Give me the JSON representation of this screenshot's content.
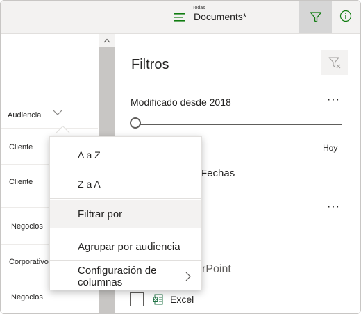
{
  "header": {
    "view_small_label": "Todas",
    "view_name": "Documents*"
  },
  "list": {
    "column_header": "Audiencia",
    "rows": [
      "Cliente",
      "Cliente",
      "Negocios",
      "Corporativo",
      "Negocios"
    ]
  },
  "filter_pane": {
    "title": "Filtros",
    "modified_section": "Modificado desde 2018",
    "slider_end_label": "Hoy",
    "dates_label": "Fechas",
    "partial_label": "rPoint",
    "excel_label": "Excel",
    "more_label": "···"
  },
  "menu": {
    "items": [
      "A a Z",
      "Z a A",
      "Filtrar por",
      "Agrupar por audiencia",
      "Configuración de columnas"
    ]
  },
  "colors": {
    "accent_green": "#107c10",
    "excel_green": "#217346"
  }
}
